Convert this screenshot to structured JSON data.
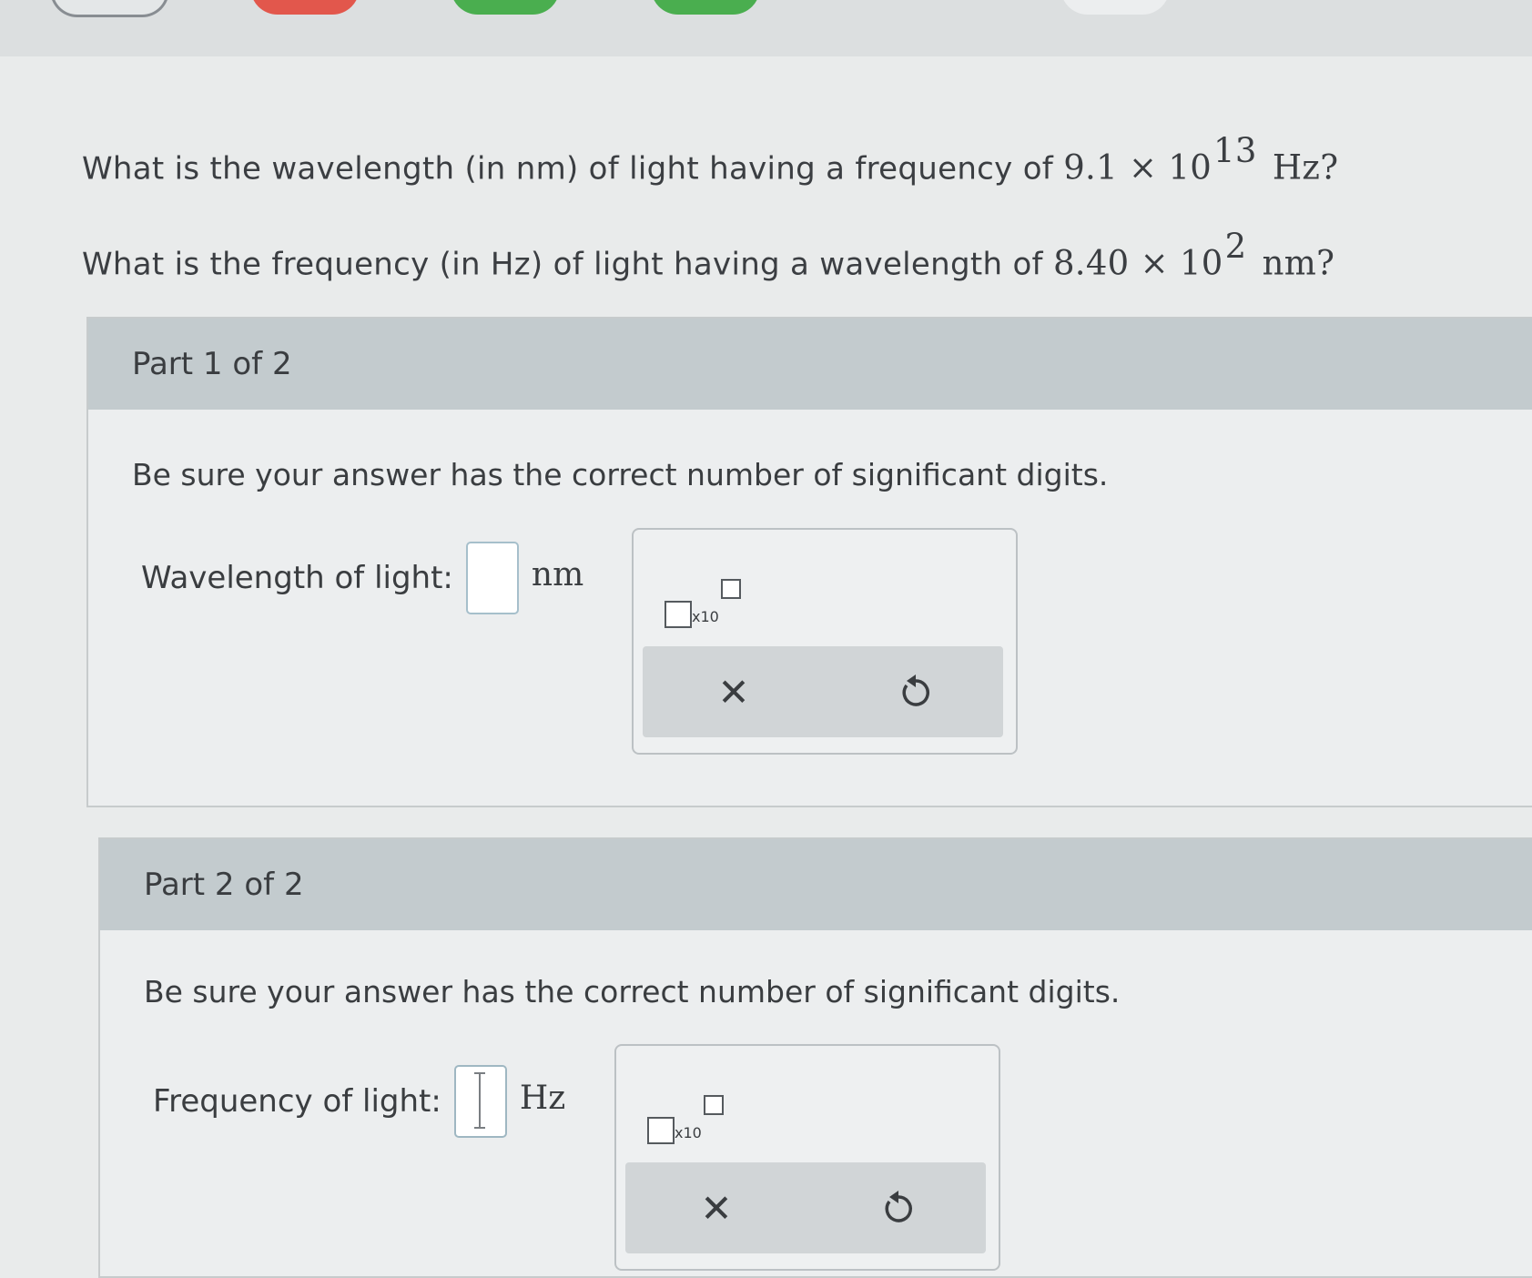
{
  "question_1": {
    "text": "What is the wavelength (in nm) of light having a frequency of",
    "coef": "9.1 × 10",
    "exp": "13",
    "unit": "Hz?"
  },
  "question_2": {
    "text": "What is the frequency (in Hz) of light having a wavelength of",
    "coef": "8.40 × 10",
    "exp": "2",
    "unit": "nm?"
  },
  "part1": {
    "header": "Part 1 of 2",
    "hint": "Be sure your answer has the correct number of significant digits.",
    "label": "Wavelength of light:",
    "value": "",
    "unit": "nm",
    "x10_label": "x10",
    "clear_symbol": "✕",
    "undo_symbol": "↺"
  },
  "part2": {
    "header": "Part 2 of 2",
    "hint": "Be sure your answer has the correct number of significant digits.",
    "label": "Frequency of light:",
    "value": "",
    "unit": "Hz",
    "x10_label": "x10",
    "clear_symbol": "✕",
    "undo_symbol": "↺"
  },
  "icons": {
    "clear": "close-icon",
    "undo": "undo-icon",
    "sci": "scientific-notation-icon"
  },
  "colors": {
    "header_bg": "#c3cbce",
    "progress_red": "#e2574c",
    "progress_green": "#4aae4f"
  }
}
